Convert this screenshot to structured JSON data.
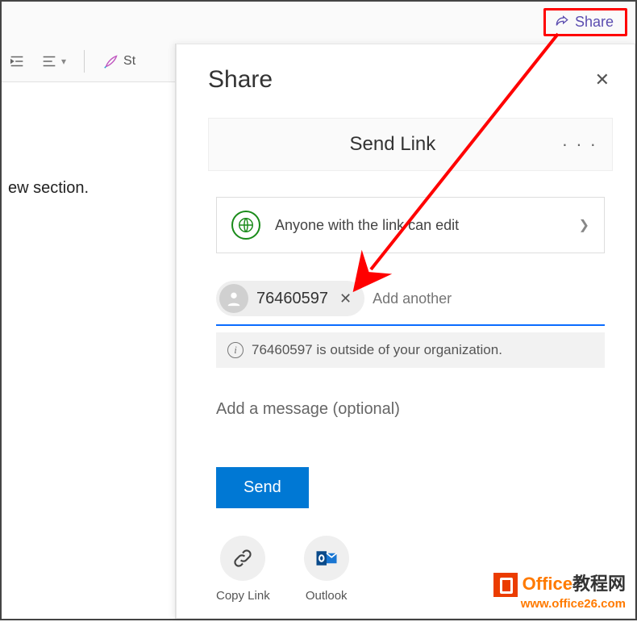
{
  "toolbar": {
    "share_label": "Share",
    "styles_label": "St"
  },
  "doc": {
    "body_text": "ew section."
  },
  "panel": {
    "title": "Share",
    "sendlink_title": "Send Link",
    "scope_text": "Anyone with the link can edit",
    "recipient_name": "76460597",
    "add_placeholder": "Add another",
    "warning_text": "76460597 is outside of your organization.",
    "message_placeholder": "Add a message (optional)",
    "send_label": "Send",
    "footer": {
      "copy_label": "Copy Link",
      "outlook_label": "Outlook"
    }
  },
  "watermark": {
    "line1_head": "Office",
    "line1_tail": "教程网",
    "line2": "www.office26.com"
  }
}
